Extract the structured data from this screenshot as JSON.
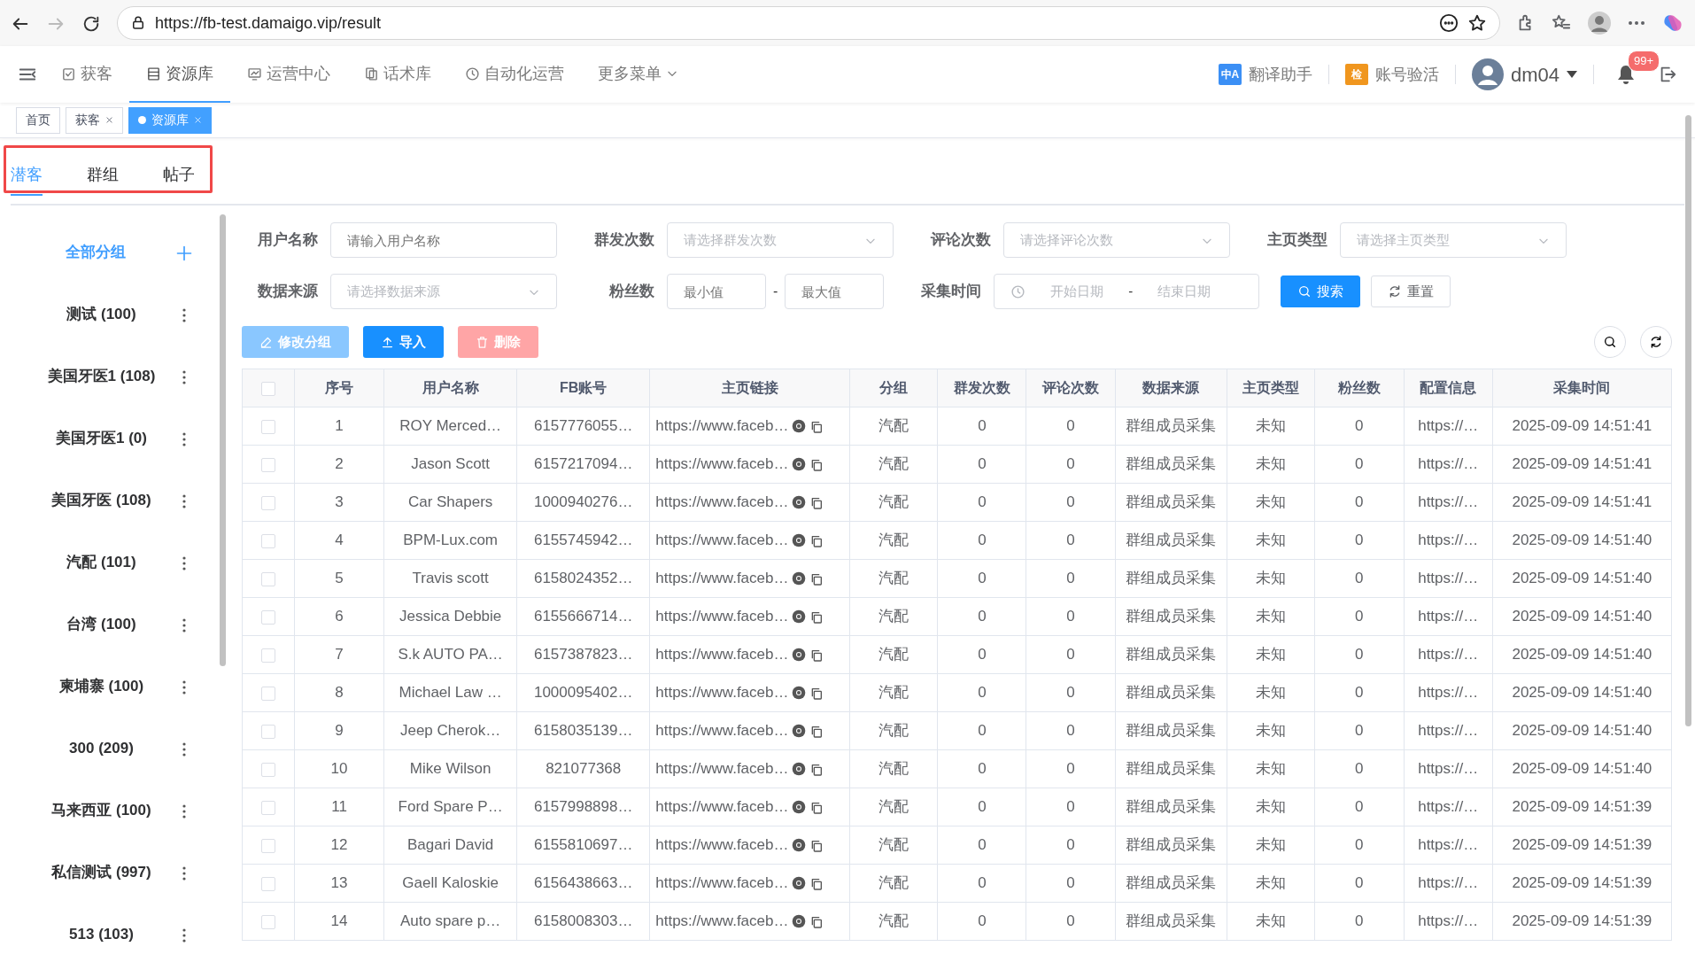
{
  "browser": {
    "url": "https://fb-test.damaigo.vip/result"
  },
  "nav": {
    "items": [
      {
        "label": "获客",
        "kind": "check",
        "selected": false
      },
      {
        "label": "资源库",
        "kind": "list",
        "selected": true
      },
      {
        "label": "运营中心",
        "kind": "monitor",
        "selected": false
      },
      {
        "label": "话术库",
        "kind": "copy",
        "selected": false
      },
      {
        "label": "自动化运营",
        "kind": "clock",
        "selected": false
      },
      {
        "label": "更多菜单",
        "kind": "caret",
        "selected": false
      }
    ],
    "tools": [
      {
        "label": "翻译助手",
        "kind": "translate",
        "badge": "中A"
      },
      {
        "label": "账号验活",
        "kind": "check",
        "badge": "检"
      }
    ],
    "user": "dm04",
    "notifications": "99+"
  },
  "tags": [
    {
      "label": "首页",
      "closable": false,
      "selected": false
    },
    {
      "label": "获客",
      "closable": true,
      "selected": false
    },
    {
      "label": "资源库",
      "closable": true,
      "selected": true
    }
  ],
  "tabs": [
    {
      "label": "潜客",
      "selected": true
    },
    {
      "label": "群组",
      "selected": false
    },
    {
      "label": "帖子",
      "selected": false
    }
  ],
  "sidebar": {
    "items": [
      {
        "label": "全部分组",
        "selected": true,
        "kind": "all"
      },
      {
        "label": "测试 (100)",
        "selected": false,
        "kind": "group"
      },
      {
        "label": "美国牙医1 (108)",
        "selected": false,
        "kind": "group"
      },
      {
        "label": "美国牙医1 (0)",
        "selected": false,
        "kind": "group"
      },
      {
        "label": "美国牙医 (108)",
        "selected": false,
        "kind": "group"
      },
      {
        "label": "汽配 (101)",
        "selected": false,
        "kind": "group"
      },
      {
        "label": "台湾 (100)",
        "selected": false,
        "kind": "group"
      },
      {
        "label": "柬埔寨 (100)",
        "selected": false,
        "kind": "group"
      },
      {
        "label": "300 (209)",
        "selected": false,
        "kind": "group"
      },
      {
        "label": "马来西亚 (100)",
        "selected": false,
        "kind": "group"
      },
      {
        "label": "私信测试 (997)",
        "selected": false,
        "kind": "group"
      },
      {
        "label": "513 (103)",
        "selected": false,
        "kind": "group"
      }
    ]
  },
  "filters": [
    {
      "label": "用户名称",
      "kind": "text",
      "placeholder": "请输入用户名称"
    },
    {
      "label": "群发次数",
      "kind": "select",
      "placeholder": "请选择群发次数"
    },
    {
      "label": "评论次数",
      "kind": "select",
      "placeholder": "请选择评论次数"
    },
    {
      "label": "主页类型",
      "kind": "select",
      "placeholder": "请选择主页类型"
    },
    {
      "label": "数据来源",
      "kind": "select",
      "placeholder": "请选择数据来源"
    },
    {
      "label": "粉丝数",
      "kind": "range",
      "placeholder": "最小值",
      "placeholder2": "最大值",
      "separator": "-"
    },
    {
      "label": "采集时间",
      "kind": "daterange",
      "placeholder": "开始日期",
      "placeholder2": "结束日期",
      "separator": "-"
    }
  ],
  "filter_buttons": [
    {
      "label": "搜索",
      "kind": "primary"
    },
    {
      "label": "重置",
      "kind": "default"
    }
  ],
  "actions": [
    {
      "label": "修改分组",
      "kind": "edit",
      "disabled": true
    },
    {
      "label": "导入",
      "kind": "import",
      "disabled": false
    },
    {
      "label": "删除",
      "kind": "delete",
      "disabled": true
    }
  ],
  "table": {
    "header_checked": false,
    "columns": [
      "序号",
      "用户名称",
      "FB账号",
      "主页链接",
      "分组",
      "群发次数",
      "评论次数",
      "数据来源",
      "主页类型",
      "粉丝数",
      "配置信息",
      "采集时间"
    ],
    "rows": [
      {
        "checked": false,
        "cells": [
          "1",
          "ROY Merced…",
          "6157776055…",
          "https://www.faceb…",
          "汽配",
          "0",
          "0",
          "群组成员采集",
          "未知",
          "0",
          "https://…",
          "2025-09-09 14:51:41"
        ]
      },
      {
        "checked": false,
        "cells": [
          "2",
          "Jason Scott",
          "6157217094…",
          "https://www.faceb…",
          "汽配",
          "0",
          "0",
          "群组成员采集",
          "未知",
          "0",
          "https://…",
          "2025-09-09 14:51:41"
        ]
      },
      {
        "checked": false,
        "cells": [
          "3",
          "Car Shapers",
          "1000940276…",
          "https://www.faceb…",
          "汽配",
          "0",
          "0",
          "群组成员采集",
          "未知",
          "0",
          "https://…",
          "2025-09-09 14:51:41"
        ]
      },
      {
        "checked": false,
        "cells": [
          "4",
          "BPM-Lux.com",
          "6155745942…",
          "https://www.faceb…",
          "汽配",
          "0",
          "0",
          "群组成员采集",
          "未知",
          "0",
          "https://…",
          "2025-09-09 14:51:40"
        ]
      },
      {
        "checked": false,
        "cells": [
          "5",
          "Travis scott",
          "6158024352…",
          "https://www.faceb…",
          "汽配",
          "0",
          "0",
          "群组成员采集",
          "未知",
          "0",
          "https://…",
          "2025-09-09 14:51:40"
        ]
      },
      {
        "checked": false,
        "cells": [
          "6",
          "Jessica Debbie",
          "6155666714…",
          "https://www.faceb…",
          "汽配",
          "0",
          "0",
          "群组成员采集",
          "未知",
          "0",
          "https://…",
          "2025-09-09 14:51:40"
        ]
      },
      {
        "checked": false,
        "cells": [
          "7",
          "S.k AUTO PA…",
          "6157387823…",
          "https://www.faceb…",
          "汽配",
          "0",
          "0",
          "群组成员采集",
          "未知",
          "0",
          "https://…",
          "2025-09-09 14:51:40"
        ]
      },
      {
        "checked": false,
        "cells": [
          "8",
          "Michael Law …",
          "1000095402…",
          "https://www.faceb…",
          "汽配",
          "0",
          "0",
          "群组成员采集",
          "未知",
          "0",
          "https://…",
          "2025-09-09 14:51:40"
        ]
      },
      {
        "checked": false,
        "cells": [
          "9",
          "Jeep Cherok…",
          "6158035139…",
          "https://www.faceb…",
          "汽配",
          "0",
          "0",
          "群组成员采集",
          "未知",
          "0",
          "https://…",
          "2025-09-09 14:51:40"
        ]
      },
      {
        "checked": false,
        "cells": [
          "10",
          "Mike Wilson",
          "821077368",
          "https://www.faceb…",
          "汽配",
          "0",
          "0",
          "群组成员采集",
          "未知",
          "0",
          "https://…",
          "2025-09-09 14:51:40"
        ]
      },
      {
        "checked": false,
        "cells": [
          "11",
          "Ford Spare P…",
          "6157998898…",
          "https://www.faceb…",
          "汽配",
          "0",
          "0",
          "群组成员采集",
          "未知",
          "0",
          "https://…",
          "2025-09-09 14:51:39"
        ]
      },
      {
        "checked": false,
        "cells": [
          "12",
          "Bagari David",
          "6155810697…",
          "https://www.faceb…",
          "汽配",
          "0",
          "0",
          "群组成员采集",
          "未知",
          "0",
          "https://…",
          "2025-09-09 14:51:39"
        ]
      },
      {
        "checked": false,
        "cells": [
          "13",
          "Gaell Kaloskie",
          "6156438663…",
          "https://www.faceb…",
          "汽配",
          "0",
          "0",
          "群组成员采集",
          "未知",
          "0",
          "https://…",
          "2025-09-09 14:51:39"
        ]
      },
      {
        "checked": false,
        "cells": [
          "14",
          "Auto spare p…",
          "6158008303…",
          "https://www.faceb…",
          "汽配",
          "0",
          "0",
          "群组成员采集",
          "未知",
          "0",
          "https://…",
          "2025-09-09 14:51:39"
        ]
      }
    ]
  }
}
